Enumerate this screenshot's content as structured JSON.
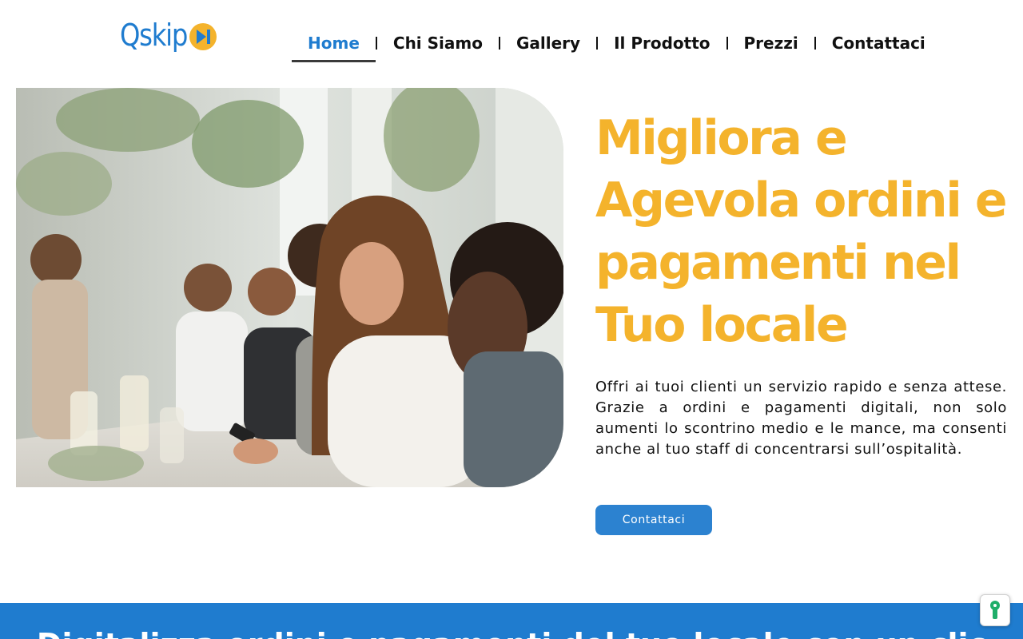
{
  "brand": {
    "name": "Qskip",
    "primary_color": "#1f7ccf",
    "accent_color": "#f4b32c"
  },
  "nav": {
    "items": [
      {
        "label": "Home",
        "active": true
      },
      {
        "label": "Chi Siamo"
      },
      {
        "label": "Gallery"
      },
      {
        "label": "Il Prodotto"
      },
      {
        "label": "Prezzi"
      },
      {
        "label": "Contattaci"
      }
    ]
  },
  "hero": {
    "image_icon": "restaurant-photo",
    "title": "Migliora e Agevola ordini e pagamenti nel Tuo locale",
    "description": "Offri ai tuoi clienti un servizio rapido e senza attese. Grazie a ordini e pagamenti digitali, non solo aumenti lo scontrino medio e le mance, ma consenti anche al tuo staff di concentrarsi sull’ospitalità.",
    "cta_label": "Contattaci"
  },
  "band": {
    "title": "Digitalizza ordini e pagamenti del tuo locale con un clic"
  },
  "cookie_widget": {
    "icon": "keyhole-icon"
  }
}
